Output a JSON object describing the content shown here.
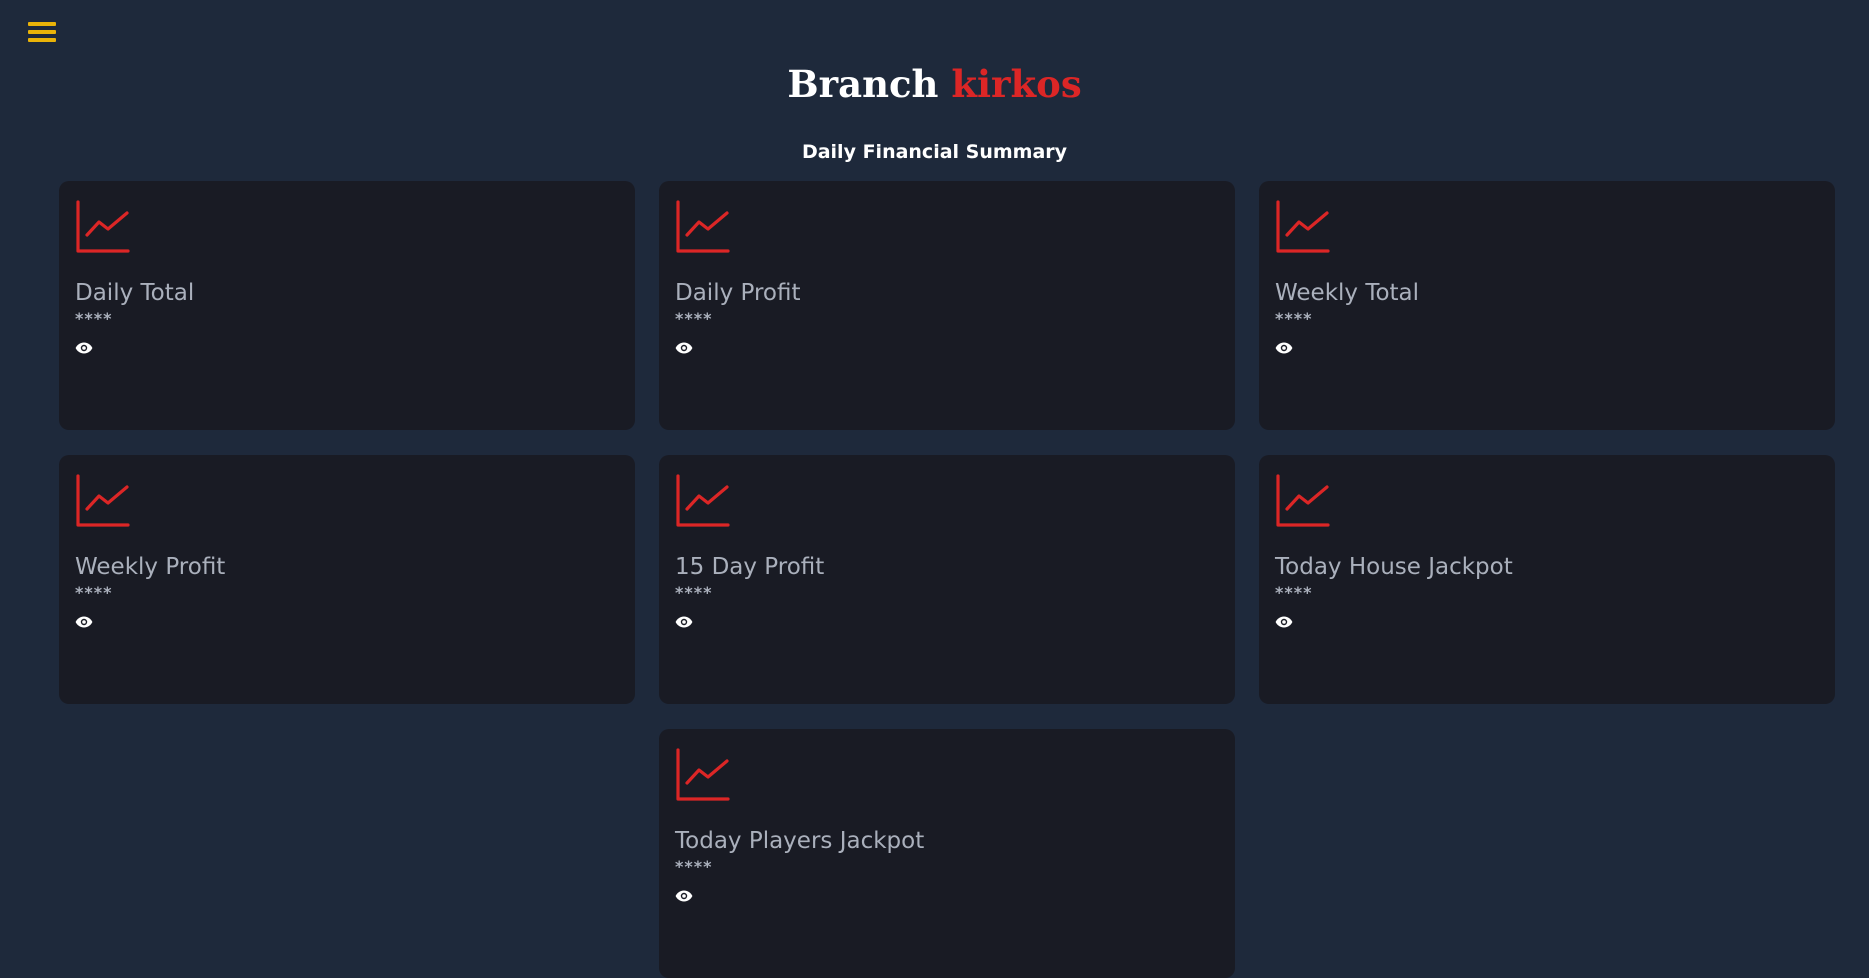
{
  "header": {
    "title_prefix": "Branch",
    "title_accent": "kirkos",
    "subtitle": "Daily Financial Summary"
  },
  "colors": {
    "background": "#1e293b",
    "card": "#191b24",
    "accent": "#dc2626",
    "menu": "#eab308"
  },
  "cards": [
    {
      "label": "Daily Total",
      "value": "****",
      "icon": "chart-line-icon"
    },
    {
      "label": "Daily Profit",
      "value": "****",
      "icon": "chart-line-icon"
    },
    {
      "label": "Weekly Total",
      "value": "****",
      "icon": "chart-line-icon"
    },
    {
      "label": "Weekly Profit",
      "value": "****",
      "icon": "chart-line-icon"
    },
    {
      "label": "15 Day Profit",
      "value": "****",
      "icon": "chart-line-icon"
    },
    {
      "label": "Today House Jackpot",
      "value": "****",
      "icon": "chart-line-icon"
    },
    {
      "label": "Today Players Jackpot",
      "value": "****",
      "icon": "chart-line-icon"
    }
  ]
}
